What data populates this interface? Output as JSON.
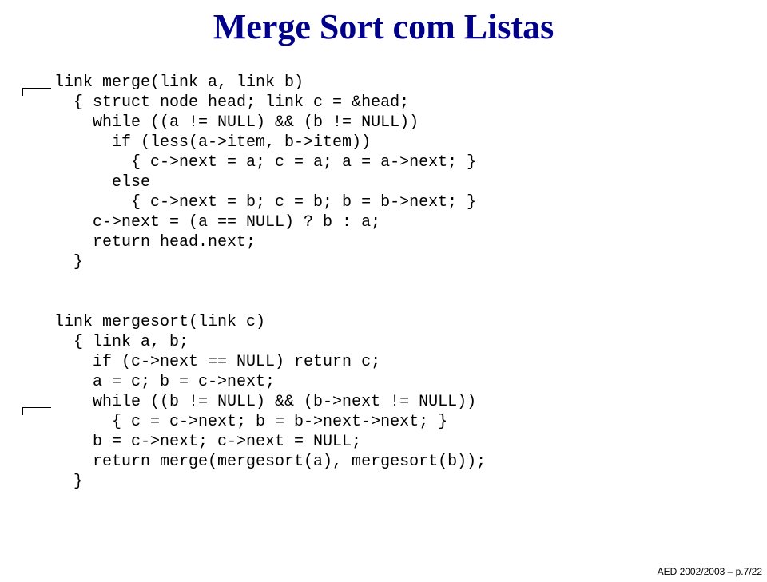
{
  "title": "Merge Sort com Listas",
  "code": "link merge(link a, link b)\n  { struct node head; link c = &head;\n    while ((a != NULL) && (b != NULL))\n      if (less(a->item, b->item))\n        { c->next = a; c = a; a = a->next; }\n      else\n        { c->next = b; c = b; b = b->next; }\n    c->next = (a == NULL) ? b : a;\n    return head.next;\n  }\n\n\nlink mergesort(link c)\n  { link a, b;\n    if (c->next == NULL) return c;\n    a = c; b = c->next;\n    while ((b != NULL) && (b->next != NULL))\n      { c = c->next; b = b->next->next; }\n    b = c->next; c->next = NULL;\n    return merge(mergesort(a), mergesort(b));\n  }",
  "footer": "AED 2002/2003 – p.7/22"
}
